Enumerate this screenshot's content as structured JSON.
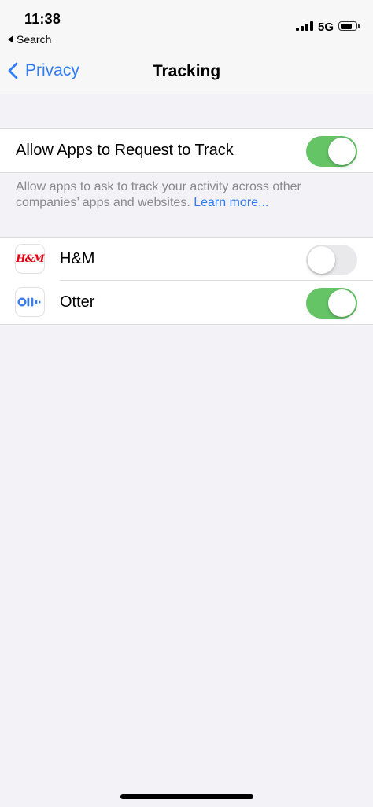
{
  "status_bar": {
    "time": "11:38",
    "back_app": "Search",
    "network": "5G"
  },
  "nav": {
    "back_label": "Privacy",
    "title": "Tracking"
  },
  "allow_tracking": {
    "label": "Allow Apps to Request to Track",
    "enabled": true
  },
  "footer": {
    "text": "Allow apps to ask to track your activity across other companies’ apps and websites.",
    "link": "Learn more..."
  },
  "apps": [
    {
      "name": "H&M",
      "icon": "hm-app-icon",
      "icon_text": "H&M",
      "enabled": false
    },
    {
      "name": "Otter",
      "icon": "otter-app-icon",
      "enabled": true
    }
  ],
  "colors": {
    "accent": "#2f7cf6",
    "toggle_on": "#65c466",
    "toggle_off": "#e9e9eb",
    "hm_red": "#e50010",
    "otter_blue": "#3c7de8"
  }
}
